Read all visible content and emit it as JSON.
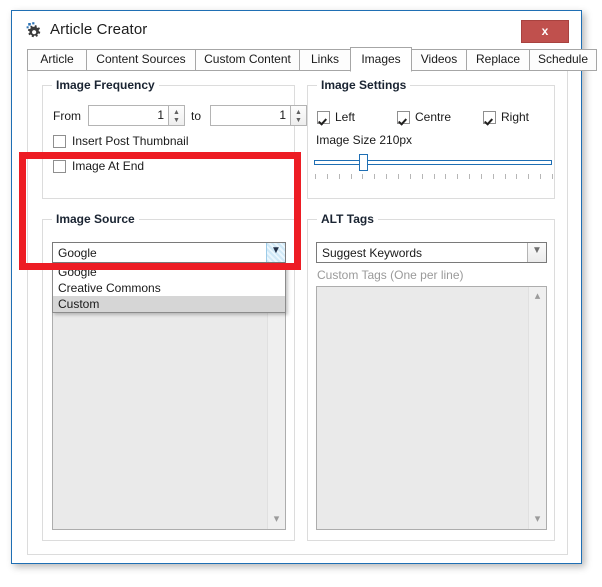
{
  "window": {
    "title": "Article Creator",
    "gear_icon": "gear-icon",
    "close_label": "x",
    "accent_color": "#1f6fb4",
    "close_color": "#c0504d"
  },
  "tabs": [
    {
      "label": "Article",
      "active": false
    },
    {
      "label": "Content Sources",
      "active": false
    },
    {
      "label": "Custom Content",
      "active": false
    },
    {
      "label": "Links",
      "active": false
    },
    {
      "label": "Images",
      "active": true
    },
    {
      "label": "Videos",
      "active": false
    },
    {
      "label": "Replace",
      "active": false
    },
    {
      "label": "Schedule",
      "active": false
    }
  ],
  "image_frequency": {
    "title": "Image Frequency",
    "from_label": "From",
    "from_value": "1",
    "to_label": "to",
    "to_value": "1",
    "checkboxes": [
      {
        "label": "Insert Post Thumbnail",
        "checked": false
      },
      {
        "label": "Image At End",
        "checked": false
      }
    ]
  },
  "image_settings": {
    "title": "Image Settings",
    "alignments": [
      {
        "label": "Left",
        "checked": true
      },
      {
        "label": "Centre",
        "checked": true
      },
      {
        "label": "Right",
        "checked": true
      }
    ],
    "size_label": "Image Size 210px",
    "size_value": "210",
    "size_unit": "px",
    "slider": {
      "min": 0,
      "max": 1000,
      "value": 210,
      "ticks": 21
    }
  },
  "image_source": {
    "title": "Image Source",
    "selected": "Google",
    "options": [
      {
        "label": "Google",
        "highlighted": false
      },
      {
        "label": "Creative Commons",
        "highlighted": false
      },
      {
        "label": "Custom",
        "highlighted": true
      }
    ],
    "dropdown_open": true
  },
  "alt_tags": {
    "title": "ALT Tags",
    "selected": "Suggest Keywords",
    "custom_tags_label": "Custom Tags (One per line)",
    "custom_tags_value": ""
  },
  "source_textarea": {
    "value": ""
  },
  "annotation": {
    "highlight_color": "#ed1c24"
  }
}
